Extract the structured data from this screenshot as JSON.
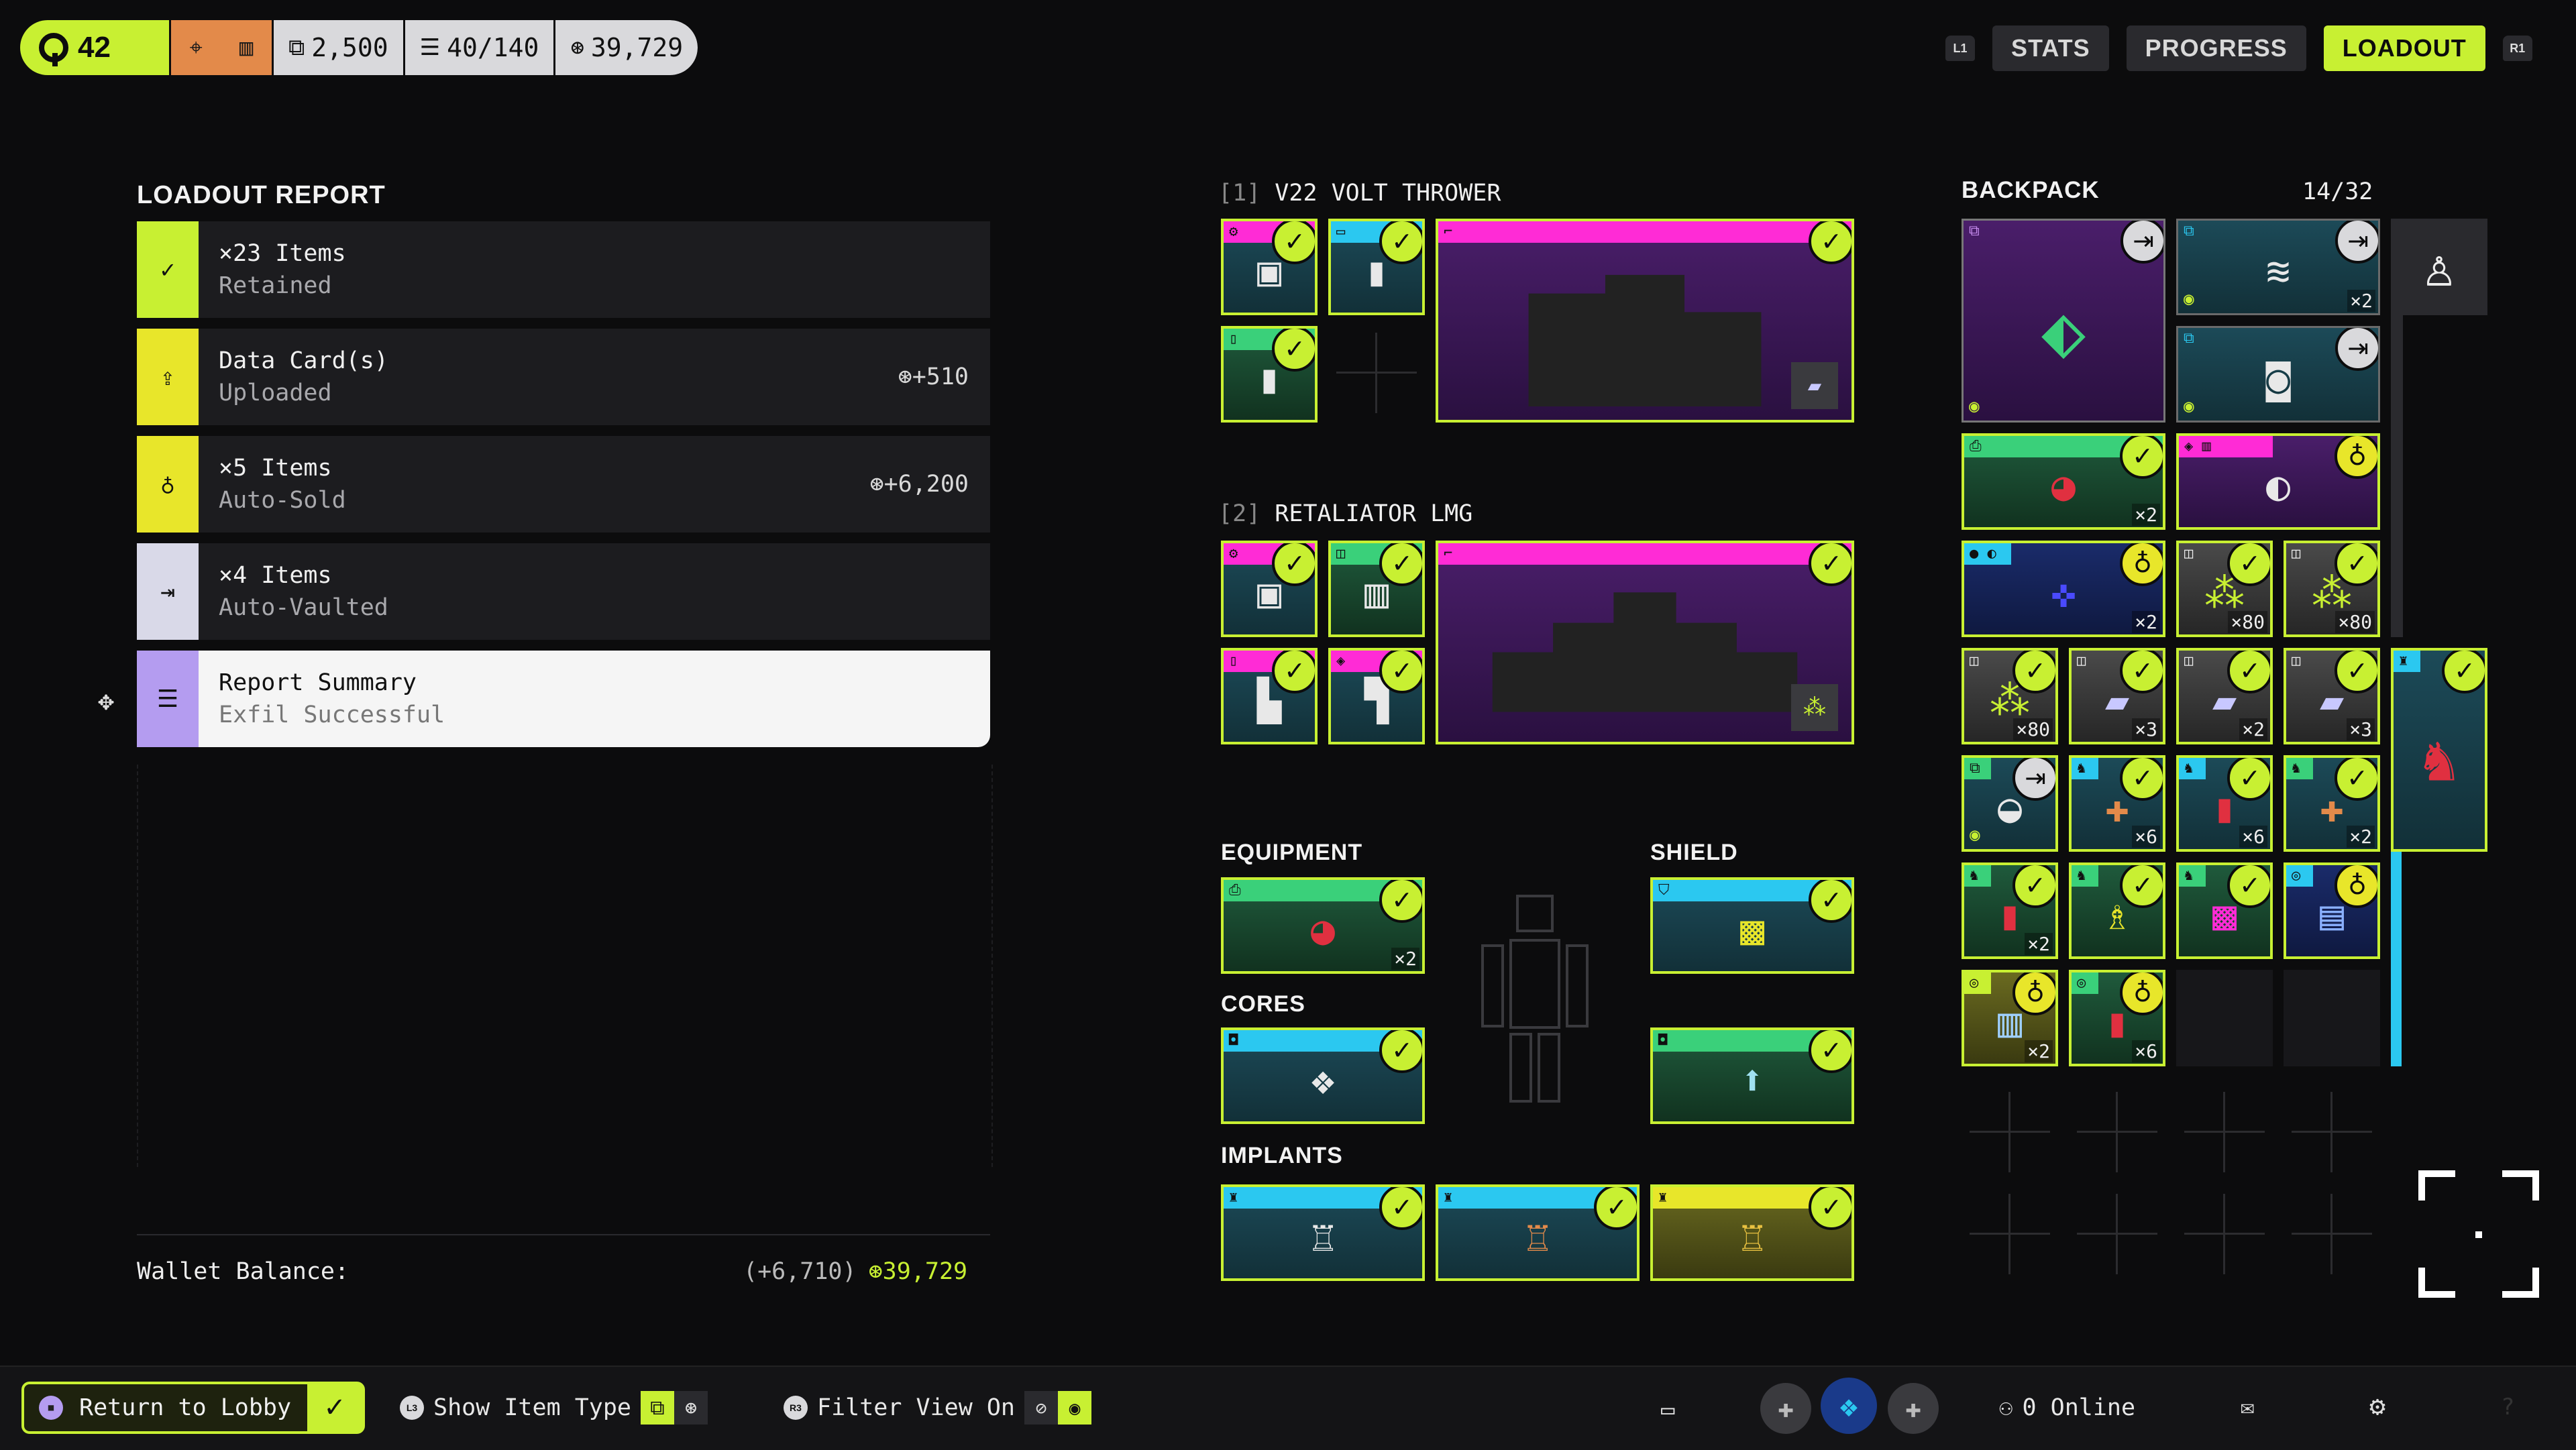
{
  "topbar": {
    "level": "42",
    "stat1": "2,500",
    "stat2": "40/140",
    "stat3": "39,729"
  },
  "tabs": {
    "left_bumper": "L1",
    "right_bumper": "R1",
    "items": [
      "STATS",
      "PROGRESS",
      "LOADOUT"
    ]
  },
  "report": {
    "title": "LOADOUT REPORT",
    "rows": [
      {
        "l1": "×23 Items",
        "l2": "Retained",
        "amount": ""
      },
      {
        "l1": "Data Card(s)",
        "l2": "Uploaded",
        "amount": "+510"
      },
      {
        "l1": "×5 Items",
        "l2": "Auto-Sold",
        "amount": "+6,200"
      },
      {
        "l1": "×4 Items",
        "l2": "Auto-Vaulted",
        "amount": ""
      },
      {
        "l1": "Report Summary",
        "l2": "Exfil Successful",
        "amount": ""
      }
    ],
    "wallet_label": "Wallet Balance:",
    "wallet_delta": "(+6,710)",
    "wallet_total": "39,729"
  },
  "weapons": {
    "w1_index": "[1]",
    "w1_name": "V22 VOLT THROWER",
    "w2_index": "[2]",
    "w2_name": "RETALIATOR LMG"
  },
  "sections": {
    "equipment": "EQUIPMENT",
    "shield": "SHIELD",
    "cores": "CORES",
    "implants": "IMPLANTS"
  },
  "backpack": {
    "title": "BACKPACK",
    "count": "14/32",
    "quantities": [
      "×2",
      "×2",
      "×2",
      "×80",
      "×80",
      "×80",
      "×3",
      "×2",
      "×3",
      "×6",
      "×6",
      "×2",
      "×2",
      "×2",
      "×6"
    ]
  },
  "equipment_qty": "×2",
  "bottombar": {
    "return_label": "Return to Lobby",
    "show_type_btn": "L3",
    "show_type_label": "Show Item Type",
    "filter_btn": "R3",
    "filter_label": "Filter View On",
    "online_label": "0 Online"
  },
  "colors": {
    "accent": "#c8f032",
    "magenta": "#ff2bd6",
    "cyan": "#2bc8f0",
    "green": "#3ad07a",
    "yellow": "#e8e62a",
    "lavender": "#b49cf0"
  }
}
